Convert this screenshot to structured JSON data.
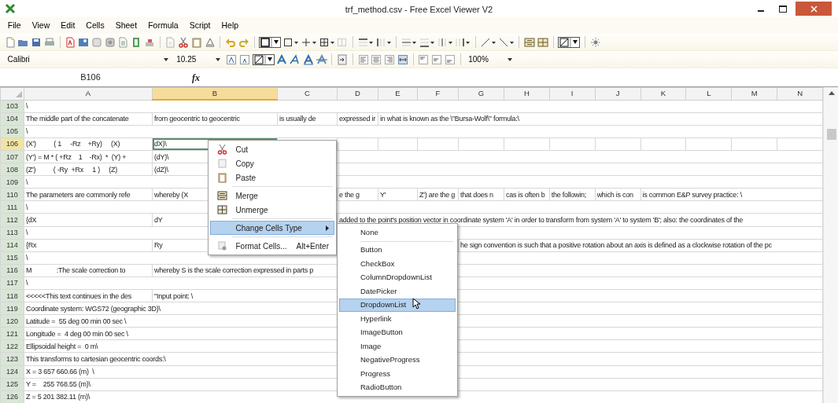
{
  "window": {
    "title": "trf_method.csv - Free Excel Viewer V2"
  },
  "menu": [
    "File",
    "View",
    "Edit",
    "Cells",
    "Sheet",
    "Formula",
    "Script",
    "Help"
  ],
  "format_toolbar": {
    "font": "Calibri",
    "size": "10.25",
    "zoom": "100%"
  },
  "formula_bar": {
    "cell_ref": "B106",
    "fx": "fx"
  },
  "sheet": {
    "columns": [
      {
        "label": "A",
        "selected": false
      },
      {
        "label": "B",
        "selected": true
      },
      {
        "label": "C",
        "selected": false
      },
      {
        "label": "D",
        "selected": false
      },
      {
        "label": "E",
        "selected": false
      },
      {
        "label": "F",
        "selected": false
      },
      {
        "label": "G",
        "selected": false
      },
      {
        "label": "H",
        "selected": false
      },
      {
        "label": "I",
        "selected": false
      },
      {
        "label": "J",
        "selected": false
      },
      {
        "label": "K",
        "selected": false
      },
      {
        "label": "L",
        "selected": false
      },
      {
        "label": "M",
        "selected": false
      },
      {
        "label": "N",
        "selected": false
      }
    ],
    "rows": [
      {
        "number": "103",
        "selected": false,
        "cells": {
          "a": "\\"
        }
      },
      {
        "number": "104",
        "selected": false,
        "cells": {
          "a": "The middle part of the concatenate",
          "b": "from geocentric to geocentric",
          "c": "is usually de",
          "d": "expressed ir",
          "e": "in what is known as the \\\"Bursa-Wolf\\\" formula:\\"
        }
      },
      {
        "number": "105",
        "selected": false,
        "cells": {
          "a": "\\"
        }
      },
      {
        "number": "106",
        "selected": true,
        "cells": {
          "a": "(X')          ( 1     -Rz    +Ry)     (X)",
          "b": "dX)\\"
        }
      },
      {
        "number": "107",
        "selected": false,
        "cells": {
          "a": "(Y') = M * ( +Rz    1    -Rx)  *  (Y) +",
          "b": "(dY)\\"
        }
      },
      {
        "number": "108",
        "selected": false,
        "cells": {
          "a": "(Z')          ( -Ry  +Rx     1 )     (Z)",
          "b": "(dZ)\\"
        }
      },
      {
        "number": "109",
        "selected": false,
        "cells": {
          "a": "\\"
        }
      },
      {
        "number": "110",
        "selected": false,
        "cells": {
          "a": "The parameters are commonly refe",
          "b": "whereby (X",
          "d": "e the g",
          "e": "Y'",
          "f": "Z') are the g",
          "g": "that does n",
          "h": "cas is often b",
          "i": "the followin;",
          "j": "which is con",
          "k": "is common E&P survey practice: \\"
        }
      },
      {
        "number": "111",
        "selected": false,
        "cells": {
          "a": "\\"
        }
      },
      {
        "number": "112",
        "selected": false,
        "cells": {
          "a": "{dX",
          "b": "dY",
          "d": "added to the point's position vector in coordinate system 'A' in order to transform from system 'A' to system 'B'; also: the coordinates of the"
        }
      },
      {
        "number": "113",
        "selected": false,
        "cells": {
          "a": "\\"
        }
      },
      {
        "number": "114",
        "selected": false,
        "cells": {
          "a": "{Rx",
          "b": "Ry",
          "g": "he sign convention is such that a positive rotation about an axis is defined as a clockwise rotation of the pc"
        }
      },
      {
        "number": "115",
        "selected": false,
        "cells": {
          "a": "\\"
        }
      },
      {
        "number": "116",
        "selected": false,
        "cells": {
          "a": "M              :The scale correction to",
          "b": "whereby S is the scale correction expressed in parts p"
        }
      },
      {
        "number": "117",
        "selected": false,
        "cells": {
          "a": "\\"
        }
      },
      {
        "number": "118",
        "selected": false,
        "cells": {
          "a": "<<<<<This text continues in the des",
          "b": "\"Input point: \\"
        }
      },
      {
        "number": "119",
        "selected": false,
        "cells": {
          "a": "Coordinate system: WGS72 (geographic 3D)\\"
        }
      },
      {
        "number": "120",
        "selected": false,
        "cells": {
          "a": "Latitude =  55 deg 00 min 00 sec \\"
        }
      },
      {
        "number": "121",
        "selected": false,
        "cells": {
          "a": "Longitude =  4 deg 00 min 00 sec \\"
        }
      },
      {
        "number": "122",
        "selected": false,
        "cells": {
          "a": "Ellipsoidal height =  0 m\\"
        }
      },
      {
        "number": "123",
        "selected": false,
        "cells": {
          "a": "This transforms to cartesian geocentric coords:\\"
        }
      },
      {
        "number": "124",
        "selected": false,
        "cells": {
          "a": "X = 3 657 660.66 (m)  \\"
        }
      },
      {
        "number": "125",
        "selected": false,
        "cells": {
          "a": "Y =    255 768.55 (m)\\"
        }
      },
      {
        "number": "126",
        "selected": false,
        "cells": {
          "a": "Z = 5 201 382.11 (m)\\"
        }
      }
    ]
  },
  "context_menu": {
    "items": [
      {
        "kind": "item",
        "label": "Cut",
        "selected": false
      },
      {
        "kind": "item",
        "label": "Copy",
        "selected": false
      },
      {
        "kind": "item",
        "label": "Paste",
        "selected": false
      },
      {
        "kind": "separator"
      },
      {
        "kind": "item",
        "label": "Merge",
        "selected": false
      },
      {
        "kind": "item",
        "label": "Unmerge",
        "selected": false
      },
      {
        "kind": "separator"
      },
      {
        "kind": "submenu",
        "label": "Change Cells Type",
        "selected": true
      },
      {
        "kind": "separator"
      },
      {
        "kind": "item",
        "label": "Format Cells...",
        "shortcut": "Alt+Enter",
        "selected": false
      }
    ]
  },
  "submenu": {
    "items": [
      {
        "kind": "item",
        "label": "None",
        "selected": false
      },
      {
        "kind": "separator"
      },
      {
        "kind": "item",
        "label": "Button",
        "selected": false
      },
      {
        "kind": "item",
        "label": "CheckBox",
        "selected": false
      },
      {
        "kind": "item",
        "label": "ColumnDropdownList",
        "selected": false
      },
      {
        "kind": "item",
        "label": "DatePicker",
        "selected": false
      },
      {
        "kind": "item",
        "label": "DropdownList",
        "selected": true
      },
      {
        "kind": "item",
        "label": "Hyperlink",
        "selected": false
      },
      {
        "kind": "item",
        "label": "ImageButton",
        "selected": false
      },
      {
        "kind": "item",
        "label": "Image",
        "selected": false
      },
      {
        "kind": "item",
        "label": "NegativeProgress",
        "selected": false
      },
      {
        "kind": "item",
        "label": "Progress",
        "selected": false
      },
      {
        "kind": "item",
        "label": "RadioButton",
        "selected": false
      }
    ]
  }
}
